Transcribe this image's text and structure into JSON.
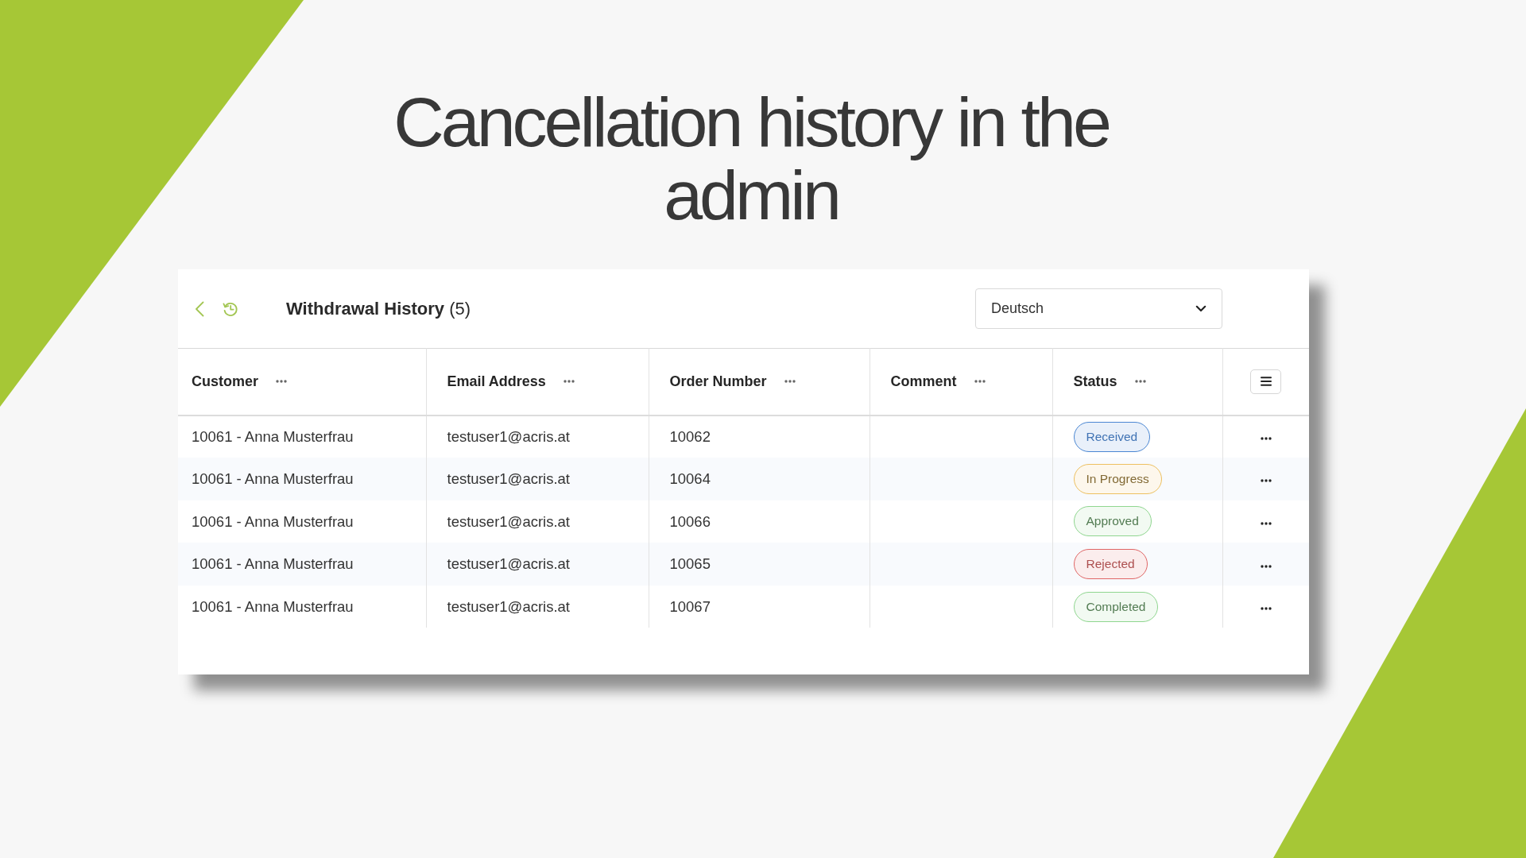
{
  "slide": {
    "title": "Cancellation history in the admin"
  },
  "panel": {
    "title": "**Withdrawal History** (5)",
    "language_select": {
      "value": "Deutsch"
    }
  },
  "table": {
    "columns": [
      {
        "label": "Customer"
      },
      {
        "label": "Email Address"
      },
      {
        "label": "Order Number"
      },
      {
        "label": "Comment"
      },
      {
        "label": "Status"
      }
    ],
    "rows": [
      {
        "customer": "10061 - Anna Musterfrau",
        "email_address": "testuser1@acris.at",
        "order_number": "10062",
        "status": {
          "label": "Received",
          "color": "#4a86d2"
        }
      },
      {
        "customer": "10061 - Anna Musterfrau",
        "email_address": "testuser1@acris.at",
        "order_number": "10064",
        "status": {
          "label": "In Progress",
          "color": "#edc060"
        }
      },
      {
        "customer": "10061 - Anna Musterfrau",
        "email_address": "testuser1@acris.at",
        "order_number": "10066",
        "status": {
          "label": "Approved",
          "color": "#8fd68f"
        }
      },
      {
        "customer": "10061 - Anna Musterfrau",
        "email_address": "testuser1@acris.at",
        "order_number": "10065",
        "status": {
          "label": "Rejected",
          "color": "#e06666"
        }
      },
      {
        "customer": "10061 - Anna Musterfrau",
        "email_address": "testuser1@acris.at",
        "order_number": "10067",
        "status": {
          "label": "Completed",
          "color": "#8fd68f"
        }
      }
    ]
  }
}
